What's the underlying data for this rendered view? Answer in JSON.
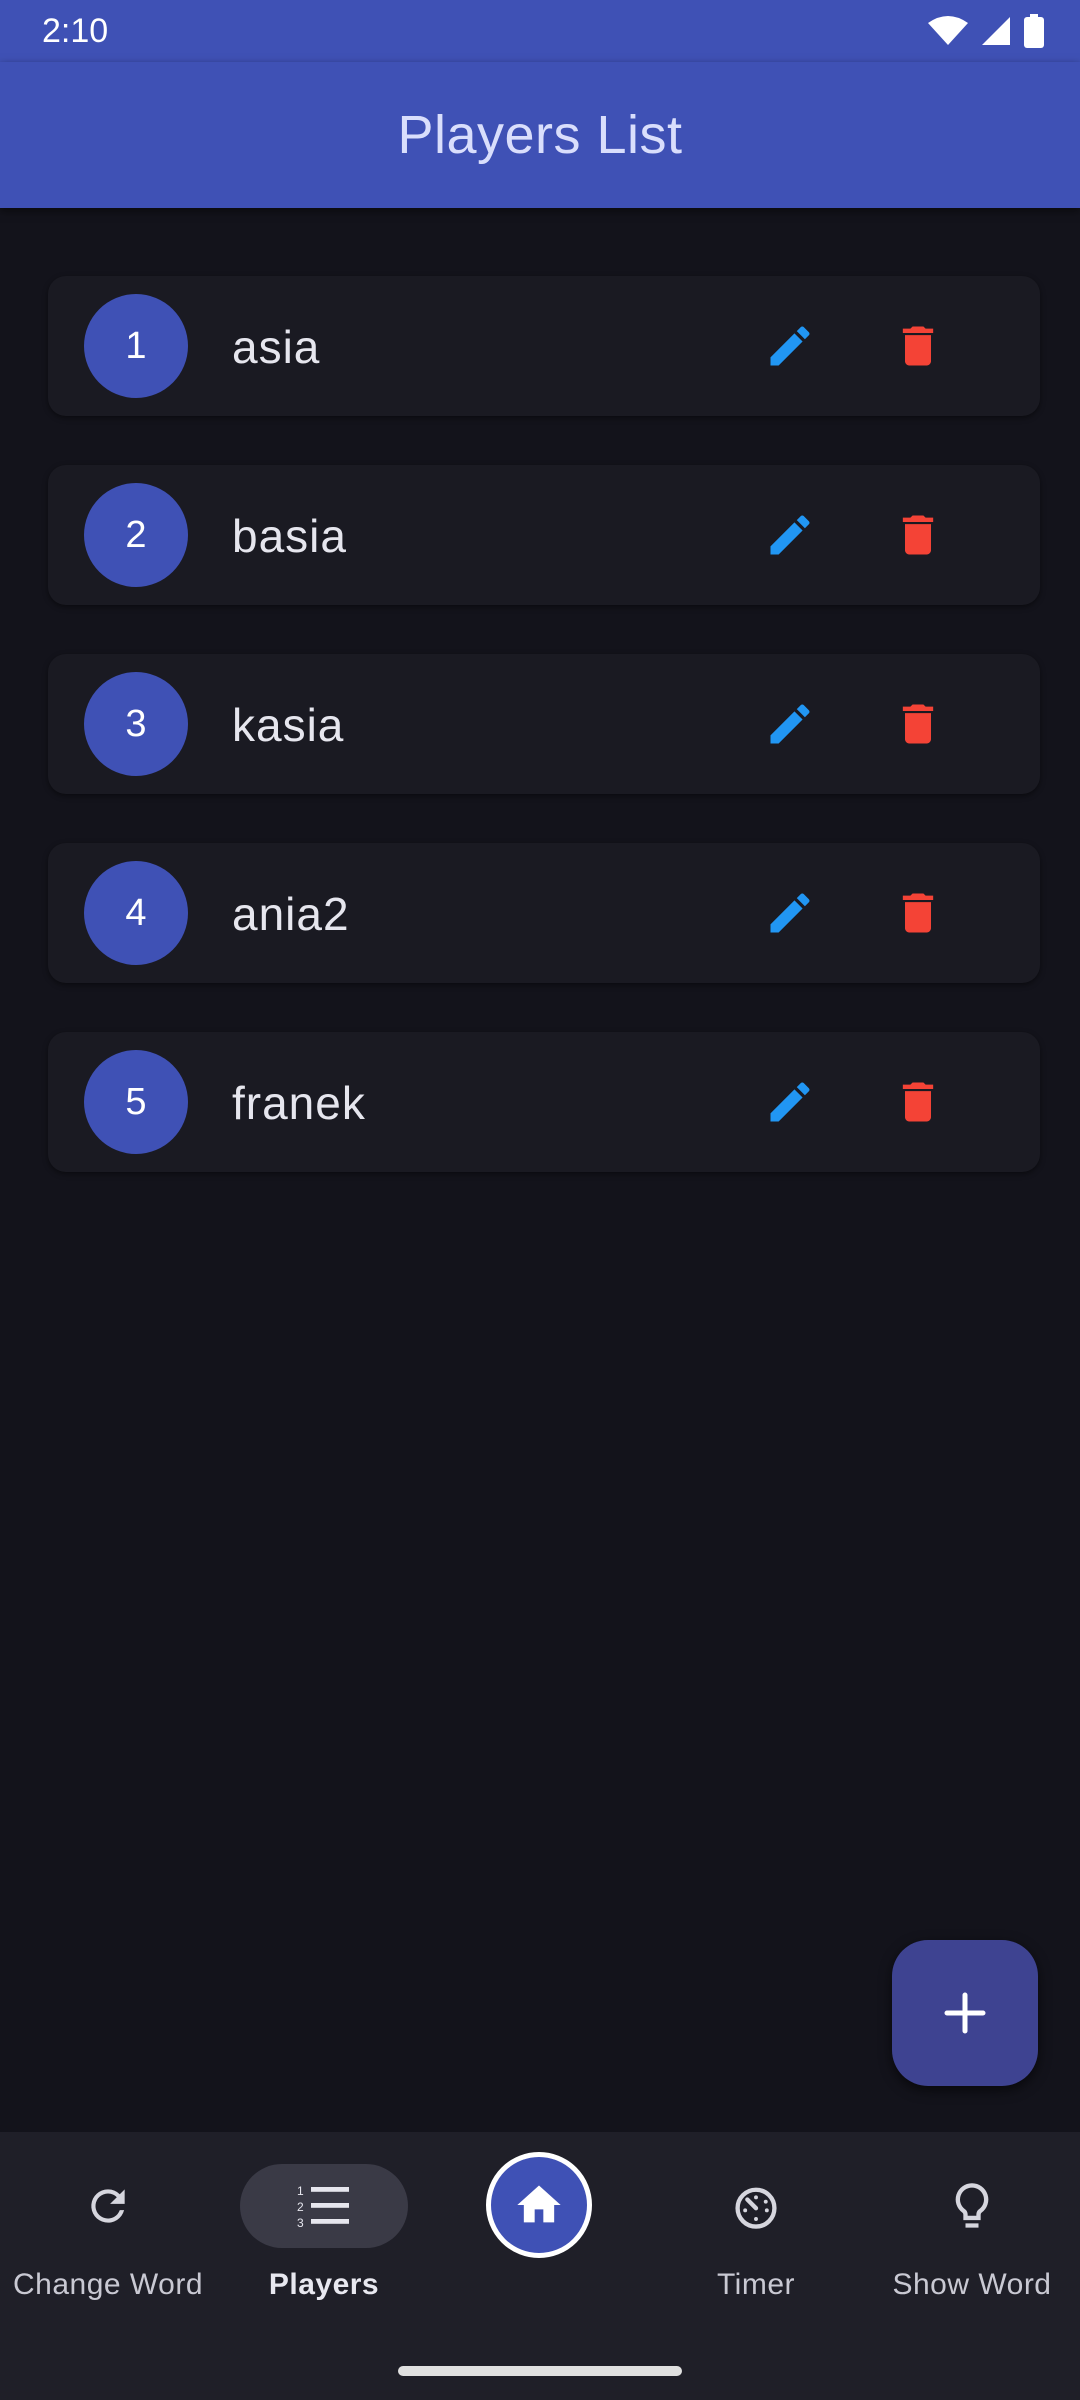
{
  "status_bar": {
    "time": "2:10"
  },
  "app_bar": {
    "title": "Players List"
  },
  "players": [
    {
      "number": "1",
      "name": "asia"
    },
    {
      "number": "2",
      "name": "basia"
    },
    {
      "number": "3",
      "name": "kasia"
    },
    {
      "number": "4",
      "name": "ania2"
    },
    {
      "number": "5",
      "name": "franek"
    }
  ],
  "icons": {
    "edit": "pencil-icon",
    "delete": "trash-icon",
    "fab": "plus-icon"
  },
  "bottom_nav": {
    "items": [
      {
        "label": "Change Word",
        "icon": "refresh-icon"
      },
      {
        "label": "Players",
        "icon": "numbered-list-icon",
        "active": true
      },
      {
        "label": "",
        "icon": "home-icon"
      },
      {
        "label": "Timer",
        "icon": "timer-icon"
      },
      {
        "label": "Show Word",
        "icon": "lightbulb-icon"
      }
    ]
  },
  "colors": {
    "primary": "#3f51b5",
    "background": "#13131b",
    "card": "#1a1a22",
    "edit": "#2196f3",
    "delete": "#f44336",
    "fab": "#3e4391"
  }
}
